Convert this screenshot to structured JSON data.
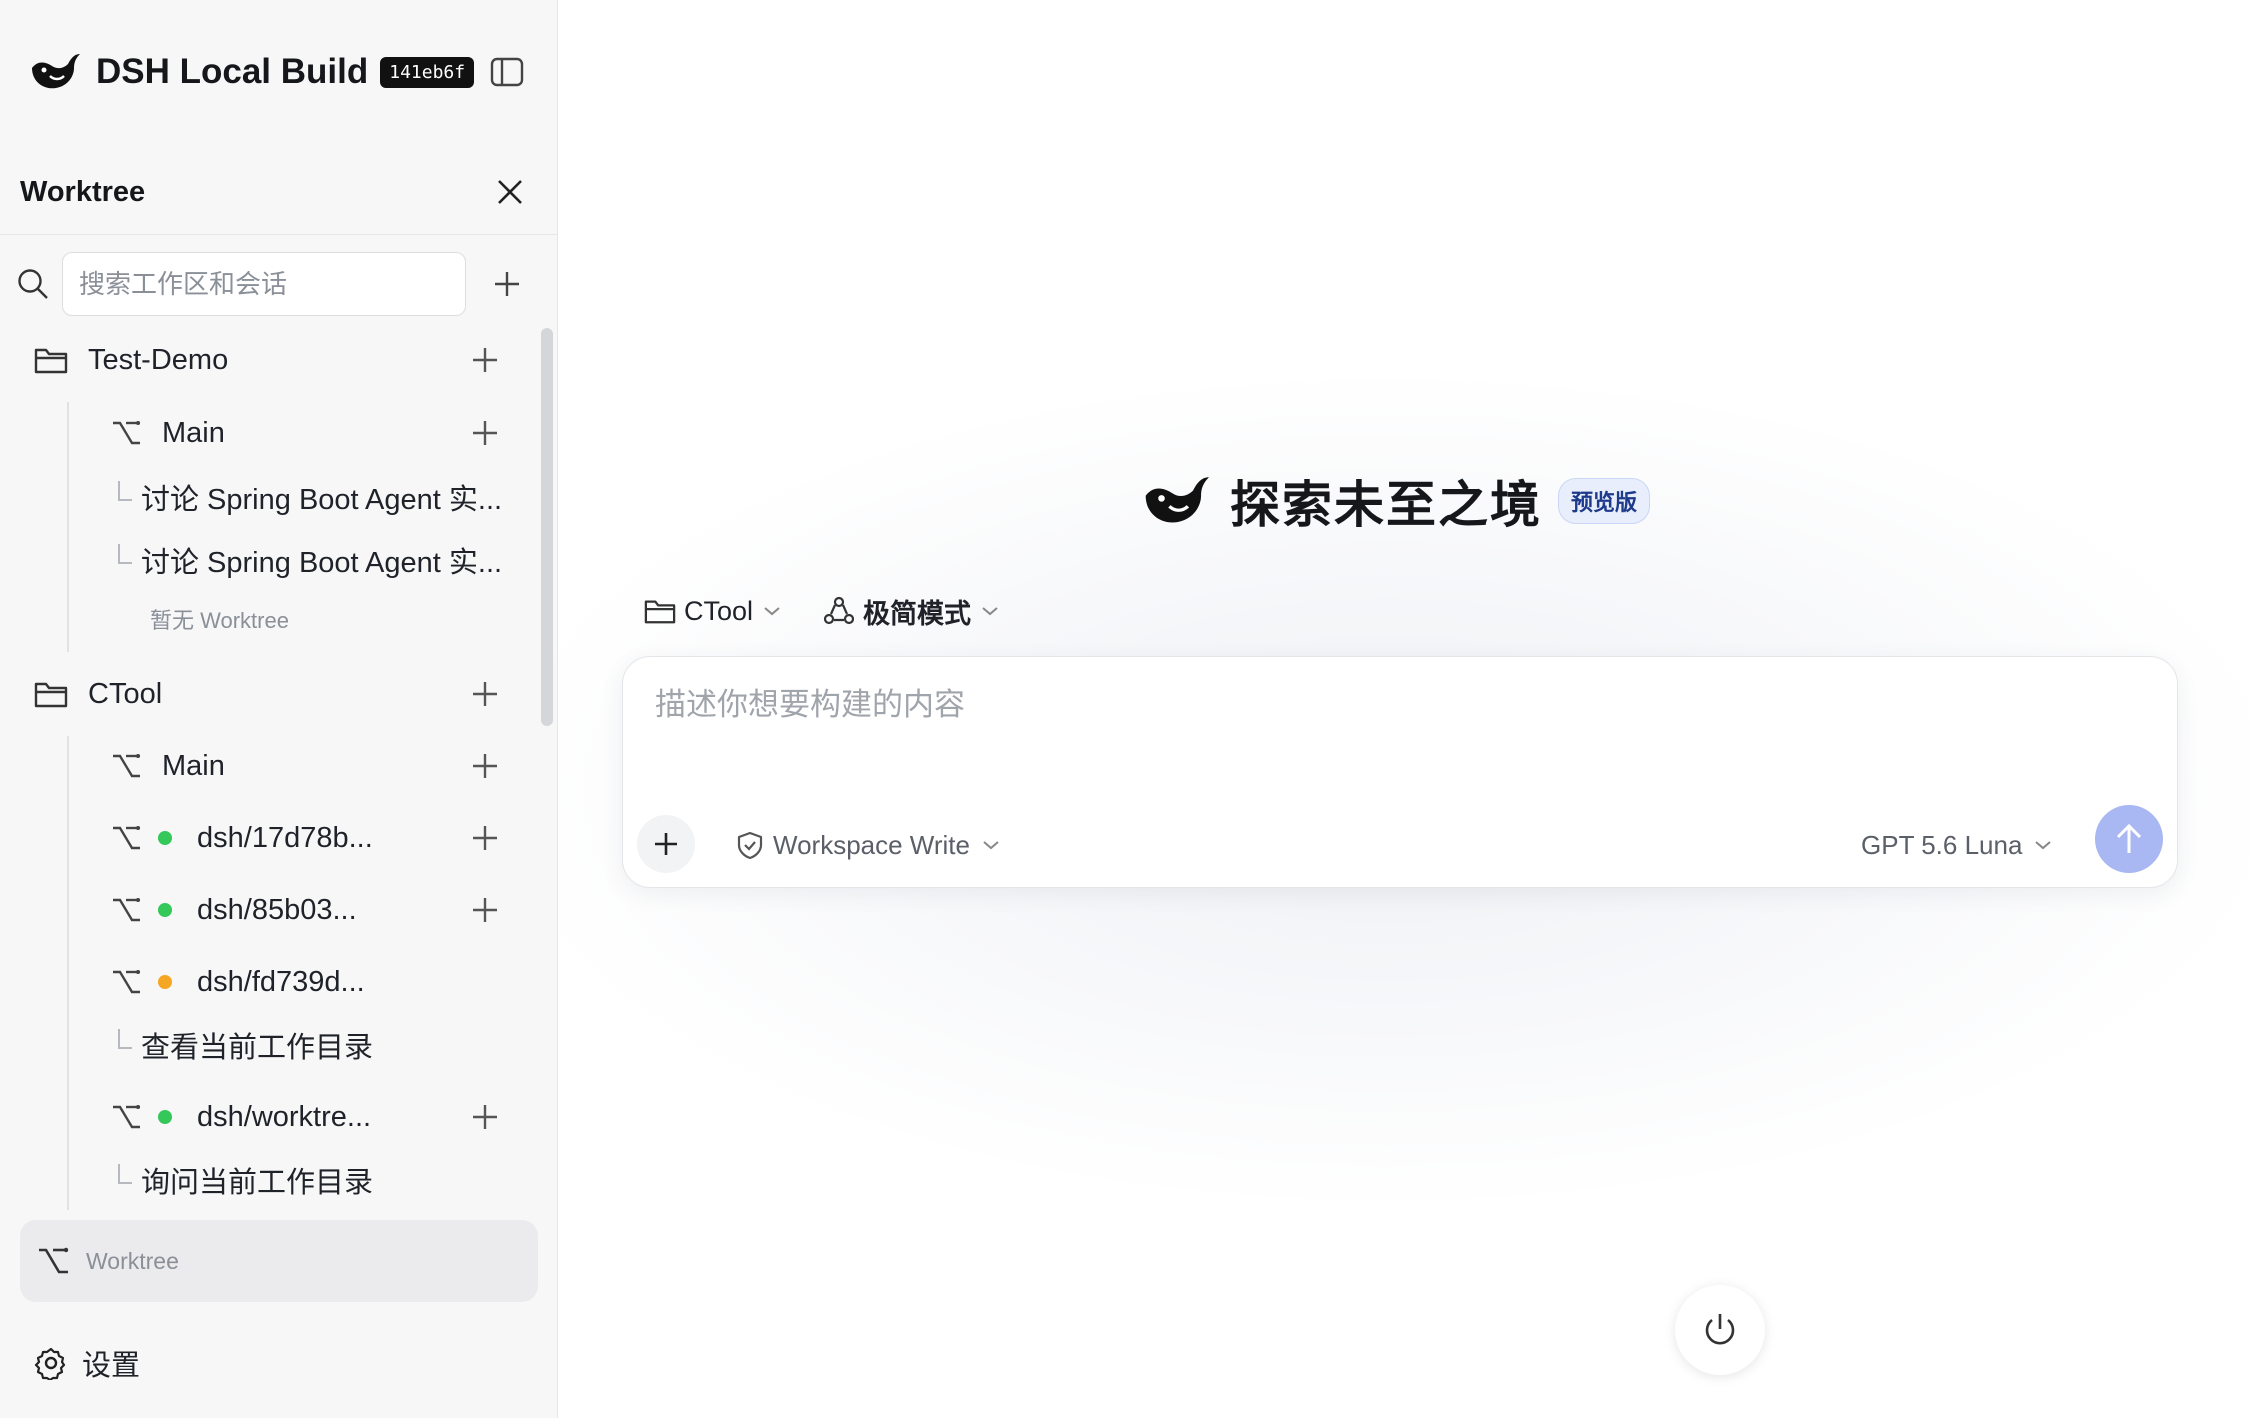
{
  "app": {
    "name": "DSH Local Build",
    "build_hash": "141eb6f"
  },
  "sidebar": {
    "worktree_title": "Worktree",
    "search": {
      "placeholder": "搜索工作区和会话",
      "value": ""
    },
    "workspaces": [
      {
        "name": "Test-Demo",
        "items": [
          {
            "kind": "branch",
            "label": "Main",
            "has_add": true
          },
          {
            "kind": "session",
            "label": "讨论 Spring Boot Agent 实..."
          },
          {
            "kind": "session",
            "label": "讨论 Spring Boot Agent 实..."
          },
          {
            "kind": "empty",
            "label": "暂无 Worktree"
          }
        ]
      },
      {
        "name": "CTool",
        "items": [
          {
            "kind": "branch",
            "label": "Main",
            "has_add": true
          },
          {
            "kind": "branch",
            "label": "dsh/17d78b...",
            "status": "green",
            "has_add": true
          },
          {
            "kind": "branch",
            "label": "dsh/85b03...",
            "status": "green",
            "has_add": true
          },
          {
            "kind": "branch",
            "label": "dsh/fd739d...",
            "status": "orange",
            "has_add": false
          },
          {
            "kind": "session",
            "label": "查看当前工作目录"
          },
          {
            "kind": "branch",
            "label": "dsh/worktre...",
            "status": "green",
            "has_add": true
          },
          {
            "kind": "session",
            "label": "询问当前工作目录"
          }
        ]
      }
    ],
    "worktree_button_label": "Worktree",
    "settings_label": "设置"
  },
  "main": {
    "hero_title": "探索未至之境",
    "hero_badge": "预览版",
    "workspace_selector": "CTool",
    "mode_selector": "极简模式",
    "composer": {
      "placeholder": "描述你想要构建的内容",
      "value": "",
      "permission": "Workspace Write",
      "model": "GPT 5.6 Luna"
    }
  },
  "colors": {
    "status_green": "#34c759",
    "status_orange": "#f5a623",
    "send_button": "#a9b8f2",
    "badge_bg": "#e8eefc",
    "badge_text": "#1e3a8a"
  },
  "icons": {
    "logo": "whale-logo-icon",
    "sidebar_toggle": "sidebar-toggle-icon",
    "close": "close-icon",
    "search": "search-icon",
    "add": "plus-icon",
    "folder": "folder-icon",
    "branch": "git-branch-icon",
    "settings": "gear-icon",
    "mode": "recycle-mode-icon",
    "permission": "shield-check-icon",
    "send": "arrow-up-icon",
    "power": "power-icon"
  }
}
